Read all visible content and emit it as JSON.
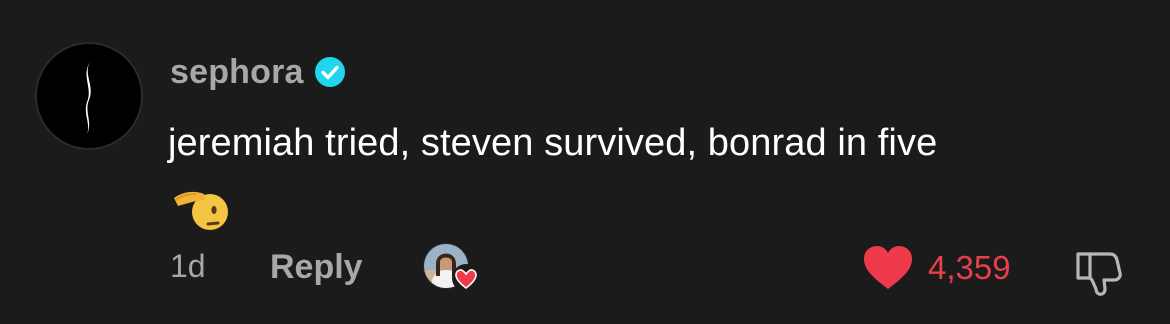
{
  "comment": {
    "username": "sephora",
    "verified": true,
    "text": "jeremiah tried, steven survived, bonrad in five",
    "emoji": "salute-emoji",
    "time": "1d",
    "reply_label": "Reply",
    "creator_liked": true,
    "like_count": "4,359",
    "liked": true
  },
  "colors": {
    "background": "#1b1b1b",
    "username": "#a8a8a8",
    "text": "#ffffff",
    "verified_badge": "#20d5ec",
    "like": "#e8404a"
  },
  "icons": {
    "verified": "verified-check-icon",
    "like": "heart-icon",
    "dislike": "thumbs-down-icon",
    "avatar_logo": "sephora-flame-logo"
  }
}
